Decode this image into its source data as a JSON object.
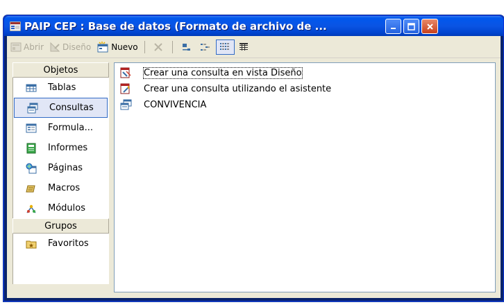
{
  "window": {
    "title": "PAIP CEP : Base de datos (Formato de archivo de ..."
  },
  "toolbar": {
    "open_label": "Abrir",
    "design_label": "Diseño",
    "new_label": "Nuevo"
  },
  "sidebar": {
    "objects_header": "Objetos",
    "items": [
      {
        "label": "Tablas",
        "icon": "table-icon"
      },
      {
        "label": "Consultas",
        "icon": "query-icon"
      },
      {
        "label": "Formula...",
        "icon": "form-icon"
      },
      {
        "label": "Informes",
        "icon": "report-icon"
      },
      {
        "label": "Páginas",
        "icon": "page-icon"
      },
      {
        "label": "Macros",
        "icon": "macro-icon"
      },
      {
        "label": "Módulos",
        "icon": "module-icon"
      }
    ],
    "groups_header": "Grupos",
    "groups": [
      {
        "label": "Favoritos",
        "icon": "favorites-folder-icon"
      }
    ]
  },
  "list": {
    "items": [
      {
        "label": "Crear una consulta en vista Diseño",
        "icon": "design-wizard-icon"
      },
      {
        "label": "Crear una consulta utilizando el asistente",
        "icon": "wizard-icon"
      },
      {
        "label": "CONVIVENCIA",
        "icon": "query-icon"
      }
    ]
  },
  "colors": {
    "titlebar": "#0054e3",
    "client": "#ece9d8",
    "selection": "#316ac5"
  }
}
